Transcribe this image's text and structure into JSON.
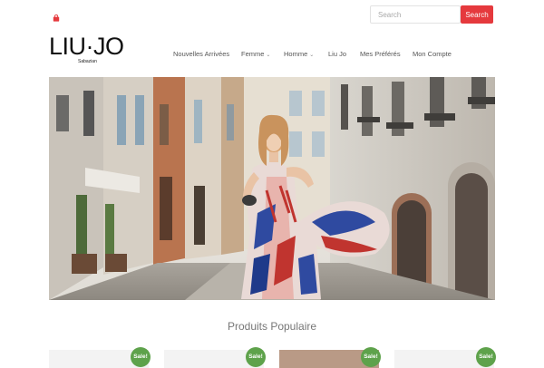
{
  "header": {
    "cart_icon": "shopping-bag-icon",
    "search_placeholder": "Search",
    "search_button_label": "Search"
  },
  "logo": {
    "text": "LIU·JO",
    "subtitle": "Sabazian"
  },
  "nav": {
    "items": [
      {
        "label": "Nouvelles Arrivées",
        "has_dropdown": false
      },
      {
        "label": "Femme",
        "has_dropdown": true
      },
      {
        "label": "Homme",
        "has_dropdown": true
      },
      {
        "label": "Liu Jo",
        "has_dropdown": false
      },
      {
        "label": "Mes Préférés",
        "has_dropdown": false
      },
      {
        "label": "Mon Compte",
        "has_dropdown": false
      }
    ],
    "dropdown_glyph": "⌄"
  },
  "hero": {
    "image": "woman-in-printed-maxi-dress-on-street"
  },
  "popular": {
    "title": "Produits Populaire",
    "products": [
      {
        "badge": "Sale!"
      },
      {
        "badge": "Sale!"
      },
      {
        "badge": "Sale!"
      },
      {
        "badge": "Sale!"
      }
    ]
  },
  "colors": {
    "accent": "#e5393d",
    "sale_badge": "#5ea24b",
    "nav_text": "#555555"
  }
}
